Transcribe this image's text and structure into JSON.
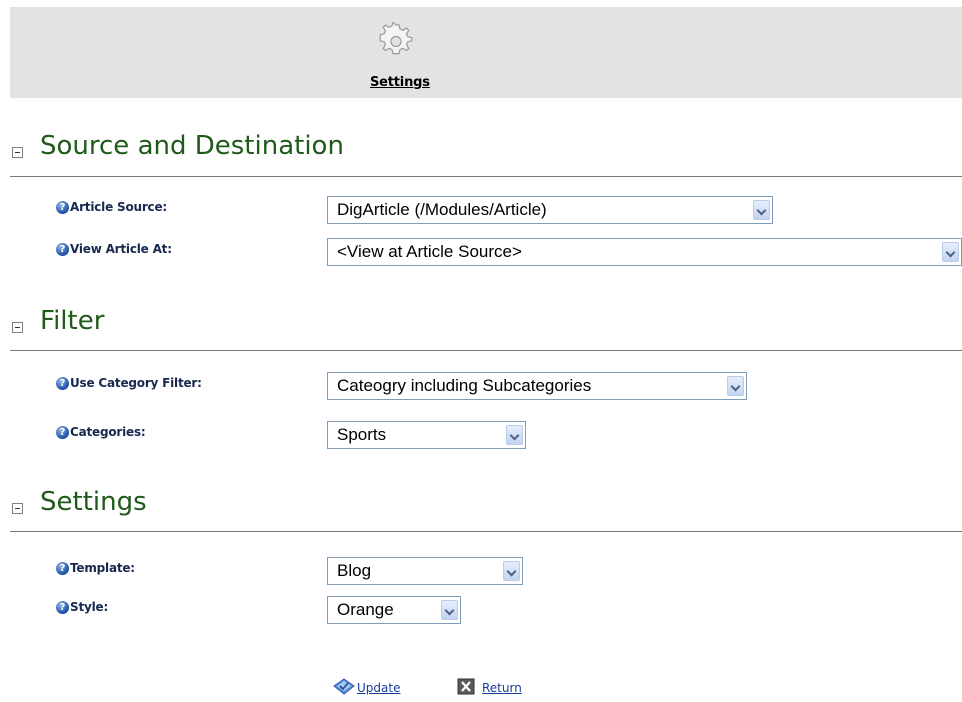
{
  "toolbar": {
    "icon": "gear-icon",
    "settings_label": "Settings"
  },
  "sections": [
    {
      "title": "Source and Destination",
      "fields": [
        {
          "label": "Article Source:",
          "value": "DigArticle (/Modules/Article)"
        },
        {
          "label": "View Article At:",
          "value": "<View at Article Source>"
        }
      ]
    },
    {
      "title": "Filter",
      "fields": [
        {
          "label": "Use Category Filter:",
          "value": "Cateogry including Subcategories"
        },
        {
          "label": "Categories:",
          "value": "Sports"
        }
      ]
    },
    {
      "title": "Settings",
      "fields": [
        {
          "label": "Template:",
          "value": "Blog"
        },
        {
          "label": "Style:",
          "value": "Orange"
        }
      ]
    }
  ],
  "actions": {
    "update_label": "Update",
    "update_icon": "update-icon",
    "return_label": "Return",
    "return_icon": "close-icon"
  },
  "colors": {
    "section_title": "#1f5a1a",
    "field_label": "#17294f",
    "link": "#1b3d9a",
    "toolbar_bg": "#e3e3e3"
  }
}
